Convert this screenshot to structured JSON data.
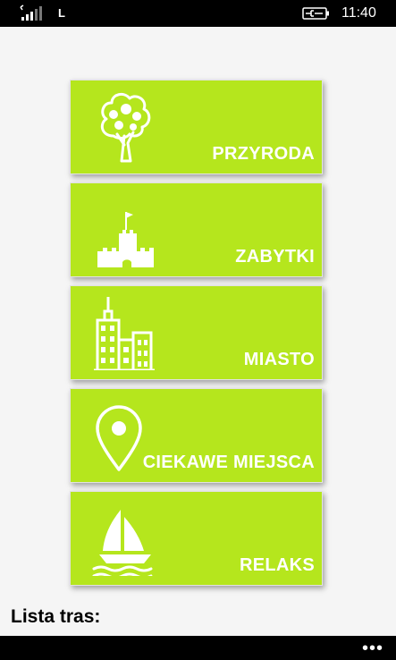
{
  "status_bar": {
    "network_label": "L",
    "time": "11:40",
    "icons": [
      "signal-strength-icon",
      "battery-charging-icon"
    ]
  },
  "menu": {
    "accent_color": "#b5e61d",
    "items": [
      {
        "label": "PRZYRODA",
        "icon": "tree-icon"
      },
      {
        "label": "ZABYTKI",
        "icon": "castle-icon"
      },
      {
        "label": "MIASTO",
        "icon": "city-buildings-icon"
      },
      {
        "label": "CIEKAWE MIEJSCA",
        "icon": "map-pin-icon"
      },
      {
        "label": "RELAKS",
        "icon": "sailboat-icon"
      }
    ]
  },
  "footer": {
    "lista_title": "Lista tras:",
    "more_label": "•••"
  }
}
